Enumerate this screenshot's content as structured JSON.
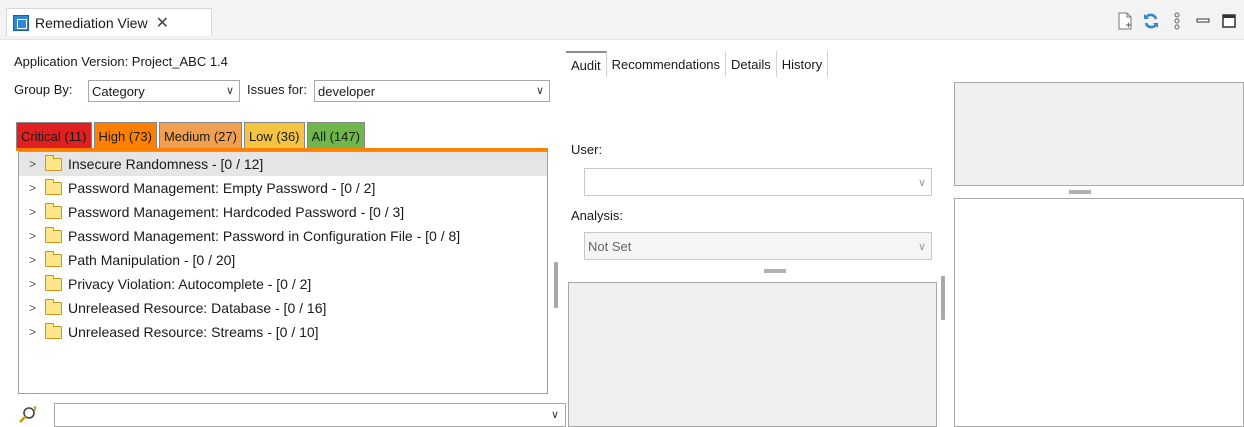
{
  "view": {
    "title": "Remediation View",
    "close_glyph": "✕",
    "toolbar_icons": [
      "new-document-icon",
      "refresh-icon",
      "view-menu-icon",
      "minimize-icon",
      "maximize-icon"
    ]
  },
  "left": {
    "app_version_label": "Application Version: Project_ABC 1.4",
    "group_by_label": "Group By:",
    "group_by_value": "Category",
    "issues_for_label": "Issues for:",
    "issues_for_value": "developer",
    "priority_tabs": [
      {
        "label": "Critical (11)",
        "color": "#e02020"
      },
      {
        "label": "High (73)",
        "color": "#ff8000"
      },
      {
        "label": "Medium (27)",
        "color": "#f0a050"
      },
      {
        "label": "Low (36)",
        "color": "#f5c542"
      },
      {
        "label": "All (147)",
        "color": "#6fb64b"
      }
    ],
    "active_priority_color": "#ff8000",
    "tree_items": [
      {
        "label": "Insecure Randomness - [0 / 12]"
      },
      {
        "label": "Password Management: Empty Password - [0 / 2]"
      },
      {
        "label": "Password Management: Hardcoded Password - [0 / 3]"
      },
      {
        "label": "Password Management: Password in Configuration File - [0 / 8]"
      },
      {
        "label": "Path Manipulation - [0 / 20]"
      },
      {
        "label": "Privacy Violation: Autocomplete - [0 / 2]"
      },
      {
        "label": "Unreleased Resource: Database - [0 / 16]"
      },
      {
        "label": "Unreleased Resource: Streams - [0 / 10]"
      }
    ],
    "filter_value": ""
  },
  "right": {
    "tabs": [
      {
        "label": "Audit"
      },
      {
        "label": "Recommendations"
      },
      {
        "label": "Details"
      },
      {
        "label": "History"
      }
    ],
    "user_label": "User:",
    "user_value": "",
    "analysis_label": "Analysis:",
    "analysis_value": "Not Set"
  }
}
